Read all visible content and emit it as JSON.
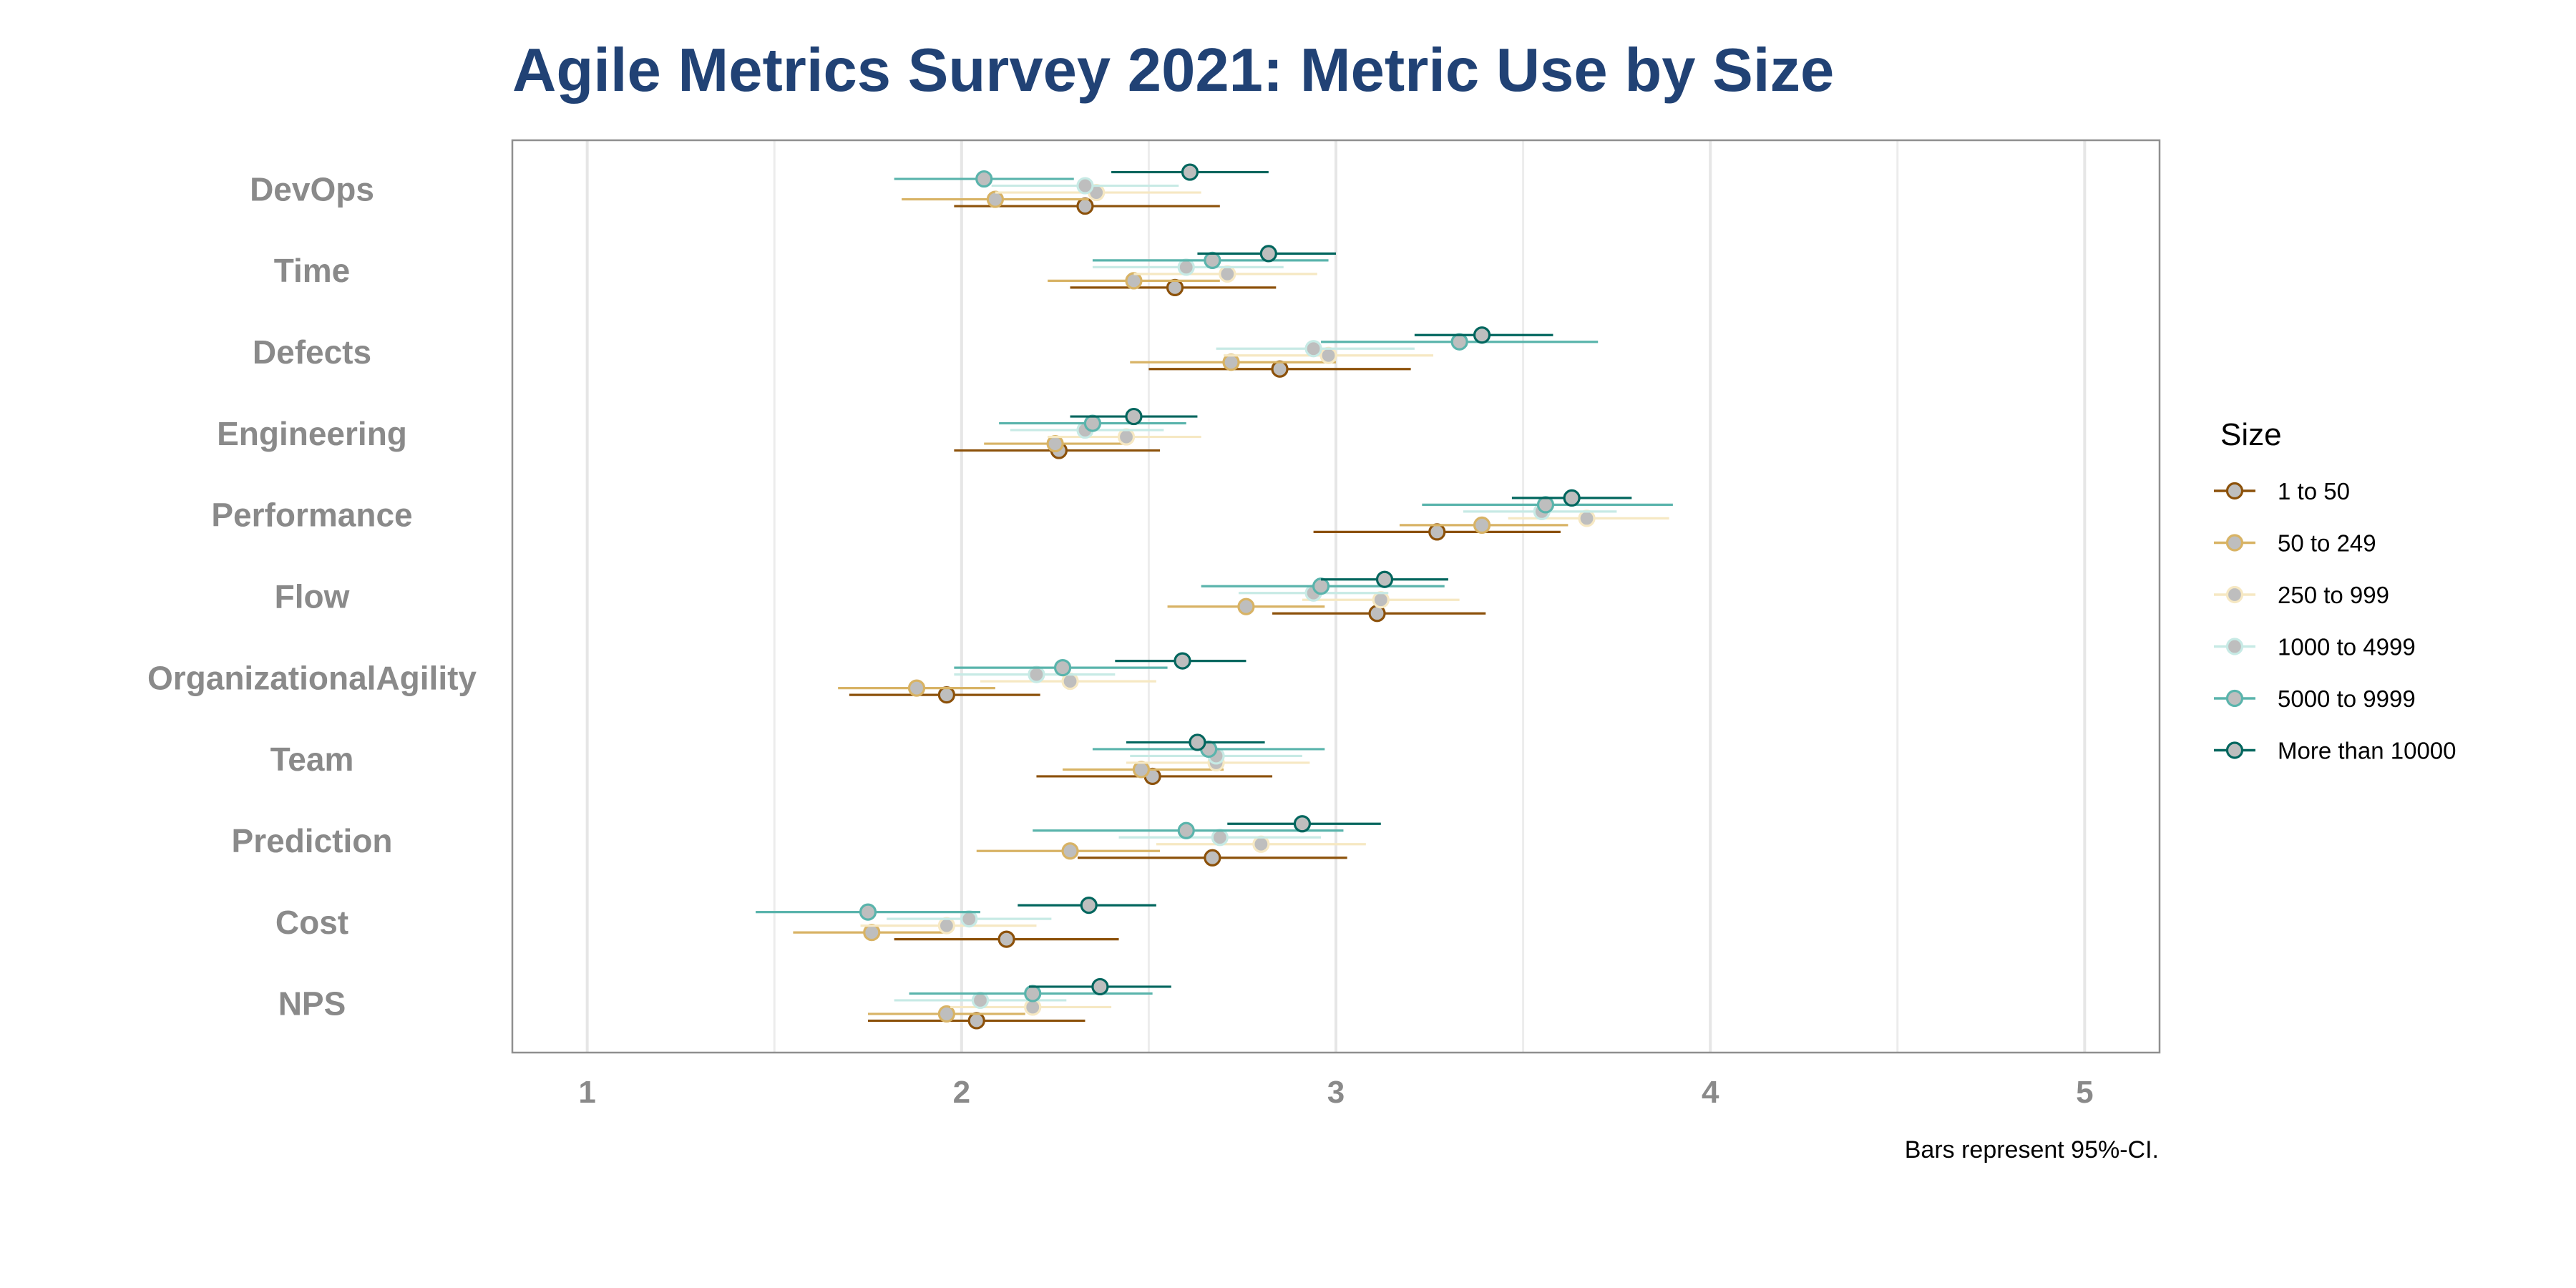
{
  "chart_data": {
    "type": "scatter",
    "subtype": "dot-and-whisker (point estimate with 95% CI error bars, dodged by group)",
    "title": "Agile Metrics Survey 2021: Metric Use by Size",
    "xlabel": "",
    "ylabel": "",
    "xlim": [
      0.8,
      5.2
    ],
    "x_ticks": [
      1,
      2,
      3,
      4,
      5
    ],
    "x_tick_labels": [
      "1",
      "2",
      "3",
      "4",
      "5"
    ],
    "grid": true,
    "caption": "Bars represent 95%-CI.",
    "legend": {
      "title": "Size",
      "position": "right"
    },
    "categories": [
      "DevOps",
      "Time",
      "Defects",
      "Engineering",
      "Performance",
      "Flow",
      "OrganizationalAgility",
      "Team",
      "Prediction",
      "Cost",
      "NPS"
    ],
    "series": [
      {
        "name": "1 to 50",
        "color": "#8c510a",
        "values": [
          2.33,
          2.57,
          2.85,
          2.26,
          3.27,
          3.11,
          1.96,
          2.51,
          2.67,
          2.12,
          2.04
        ],
        "ci_low": [
          1.98,
          2.29,
          2.5,
          1.98,
          2.94,
          2.83,
          1.7,
          2.2,
          2.31,
          1.82,
          1.75
        ],
        "ci_high": [
          2.69,
          2.84,
          3.2,
          2.53,
          3.6,
          3.4,
          2.21,
          2.83,
          3.03,
          2.42,
          2.33
        ]
      },
      {
        "name": "50 to 249",
        "color": "#d8b365",
        "values": [
          2.09,
          2.46,
          2.72,
          2.25,
          3.39,
          2.76,
          1.88,
          2.48,
          2.29,
          1.76,
          1.96
        ],
        "ci_low": [
          1.84,
          2.23,
          2.45,
          2.06,
          3.17,
          2.55,
          1.67,
          2.27,
          2.04,
          1.55,
          1.75
        ],
        "ci_high": [
          2.34,
          2.69,
          3.0,
          2.45,
          3.62,
          2.97,
          2.09,
          2.7,
          2.53,
          1.96,
          2.17
        ]
      },
      {
        "name": "250 to 999",
        "color": "#f6e8c3",
        "values": [
          2.36,
          2.71,
          2.98,
          2.44,
          3.67,
          3.12,
          2.29,
          2.68,
          2.8,
          1.96,
          2.19
        ],
        "ci_low": [
          2.09,
          2.46,
          2.7,
          2.23,
          3.46,
          2.91,
          2.05,
          2.44,
          2.52,
          1.73,
          1.97
        ],
        "ci_high": [
          2.64,
          2.95,
          3.26,
          2.64,
          3.89,
          3.33,
          2.52,
          2.93,
          3.08,
          2.2,
          2.4
        ]
      },
      {
        "name": "1000 to 4999",
        "color": "#c7eae5",
        "values": [
          2.33,
          2.6,
          2.94,
          2.33,
          3.55,
          2.94,
          2.2,
          2.68,
          2.69,
          2.02,
          2.05
        ],
        "ci_low": [
          2.08,
          2.35,
          2.68,
          2.13,
          3.34,
          2.74,
          1.98,
          2.45,
          2.42,
          1.8,
          1.82
        ],
        "ci_high": [
          2.58,
          2.86,
          3.21,
          2.54,
          3.75,
          3.14,
          2.41,
          2.91,
          2.96,
          2.24,
          2.28
        ]
      },
      {
        "name": "5000 to 9999",
        "color": "#5ab4ac",
        "values": [
          2.06,
          2.67,
          3.33,
          2.35,
          3.56,
          2.96,
          2.27,
          2.66,
          2.6,
          1.75,
          2.19
        ],
        "ci_low": [
          1.82,
          2.35,
          2.96,
          2.1,
          3.23,
          2.64,
          1.98,
          2.35,
          2.19,
          1.45,
          1.86
        ],
        "ci_high": [
          2.3,
          2.98,
          3.7,
          2.6,
          3.9,
          3.29,
          2.55,
          2.97,
          3.02,
          2.05,
          2.51
        ]
      },
      {
        "name": "More than 10000",
        "color": "#01665e",
        "values": [
          2.61,
          2.82,
          3.39,
          2.46,
          3.63,
          3.13,
          2.59,
          2.63,
          2.91,
          2.34,
          2.37
        ],
        "ci_low": [
          2.4,
          2.63,
          3.21,
          2.29,
          3.47,
          2.96,
          2.41,
          2.44,
          2.71,
          2.15,
          2.18
        ],
        "ci_high": [
          2.82,
          3.0,
          3.58,
          2.63,
          3.79,
          3.3,
          2.76,
          2.81,
          3.12,
          2.52,
          2.56
        ]
      }
    ]
  }
}
